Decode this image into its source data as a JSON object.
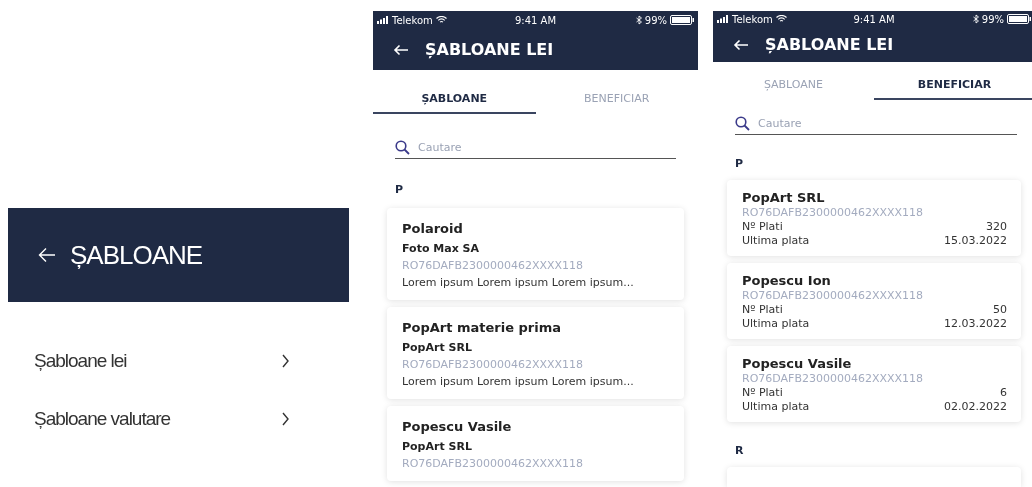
{
  "screens": [
    {
      "kind": "menu",
      "header": {
        "title": "ȘABLOANE"
      },
      "items": [
        {
          "label": "Șabloane lei"
        },
        {
          "label": "Șabloane valutare"
        }
      ]
    },
    {
      "kind": "templates",
      "status_bar": {
        "carrier": "Telekom",
        "time": "9:41 AM",
        "battery": "99%"
      },
      "header": {
        "title": "ȘABLOANE LEI"
      },
      "tabs": [
        {
          "label": "ȘABLOANE",
          "selected": true
        },
        {
          "label": "BENEFICIAR",
          "selected": false
        }
      ],
      "search": {
        "placeholder": "Cautare"
      },
      "sections": [
        {
          "letter": "P",
          "cards": [
            {
              "title": "Polaroid",
              "company": "Foto Max SA",
              "iban": "RO76DAFB2300000462XXXX118",
              "note": "Lorem ipsum Lorem ipsum Lorem ipsum..."
            },
            {
              "title": "PopArt materie prima",
              "company": "PopArt SRL",
              "iban": "RO76DAFB2300000462XXXX118",
              "note": "Lorem ipsum Lorem ipsum Lorem ipsum..."
            },
            {
              "title": "Popescu Vasile",
              "company": "PopArt SRL",
              "iban": "RO76DAFB2300000462XXXX118"
            }
          ]
        }
      ]
    },
    {
      "kind": "beneficiaries",
      "status_bar": {
        "carrier": "Telekom",
        "time": "9:41 AM",
        "battery": "99%"
      },
      "header": {
        "title": "ȘABLOANE LEI"
      },
      "tabs": [
        {
          "label": "ȘABLOANE",
          "selected": false
        },
        {
          "label": "BENEFICIAR",
          "selected": true
        }
      ],
      "search": {
        "placeholder": "Cautare"
      },
      "more_below": true,
      "sections": [
        {
          "letter": "P",
          "cards": [
            {
              "title": "PopArt SRL",
              "iban": "RO76DAFB2300000462XXXX118",
              "rows": [
                {
                  "label": "Nº Plati",
                  "value": "320"
                },
                {
                  "label": "Ultima plata",
                  "value": "15.03.2022"
                }
              ]
            },
            {
              "title": "Popescu Ion",
              "iban": "RO76DAFB2300000462XXXX118",
              "rows": [
                {
                  "label": "Nº Plati",
                  "value": "50"
                },
                {
                  "label": "Ultima plata",
                  "value": "12.03.2022"
                }
              ]
            },
            {
              "title": "Popescu Vasile",
              "iban": "RO76DAFB2300000462XXXX118",
              "rows": [
                {
                  "label": "Nº Plati",
                  "value": "6"
                },
                {
                  "label": "Ultima plata",
                  "value": "02.02.2022"
                }
              ]
            }
          ]
        },
        {
          "letter": "R"
        }
      ]
    }
  ]
}
